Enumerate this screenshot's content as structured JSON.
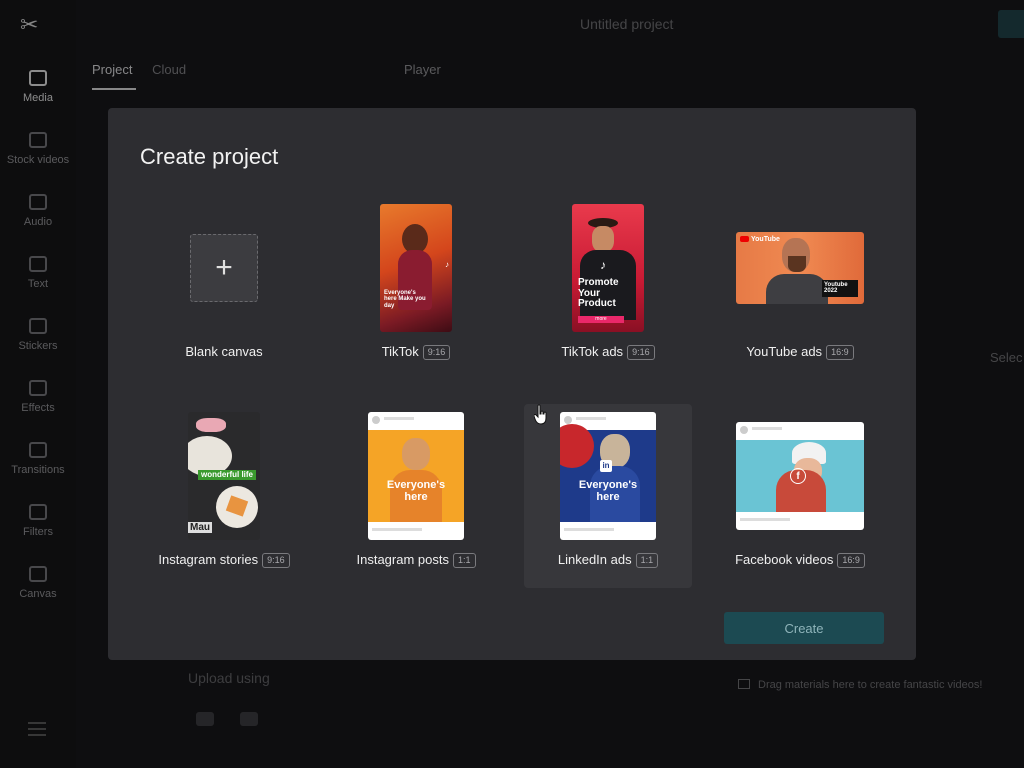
{
  "app": {
    "title": "Untitled project",
    "sidebar": [
      {
        "label": "Media",
        "icon": "media-icon",
        "active": true
      },
      {
        "label": "Stock videos",
        "icon": "stock-videos-icon"
      },
      {
        "label": "Audio",
        "icon": "audio-icon"
      },
      {
        "label": "Text",
        "icon": "text-icon"
      },
      {
        "label": "Stickers",
        "icon": "stickers-icon"
      },
      {
        "label": "Effects",
        "icon": "effects-icon"
      },
      {
        "label": "Transitions",
        "icon": "transitions-icon"
      },
      {
        "label": "Filters",
        "icon": "filters-icon"
      },
      {
        "label": "Canvas",
        "icon": "canvas-icon"
      }
    ],
    "tabs": [
      "Project",
      "Cloud"
    ],
    "player_label": "Player",
    "select_label": "Selec",
    "upload_label": "Upload using",
    "drag_hint": "Drag materials here to create fantastic videos!"
  },
  "modal": {
    "title": "Create project",
    "create_label": "Create",
    "options": [
      {
        "label": "Blank canvas",
        "ratio": ""
      },
      {
        "label": "TikTok",
        "ratio": "9:16",
        "thumb_text": "Everyone's here Make you day"
      },
      {
        "label": "TikTok ads",
        "ratio": "9:16",
        "thumb_text": "Promote Your Product",
        "thumb_button": "more"
      },
      {
        "label": "YouTube ads",
        "ratio": "16:9",
        "thumb_brand": "YouTube",
        "thumb_text": "Youtube 2022"
      },
      {
        "label": "Instagram stories",
        "ratio": "9:16",
        "thumb_text": "wonderful life",
        "thumb_sub": "Mau"
      },
      {
        "label": "Instagram posts",
        "ratio": "1:1",
        "thumb_text": "Everyone's here"
      },
      {
        "label": "LinkedIn ads",
        "ratio": "1:1",
        "thumb_text": "Everyone's here"
      },
      {
        "label": "Facebook videos",
        "ratio": "16:9"
      }
    ]
  },
  "colors": {
    "accent": "#1c4a52",
    "modal_bg": "#2d2d31",
    "app_bg": "#161619"
  }
}
